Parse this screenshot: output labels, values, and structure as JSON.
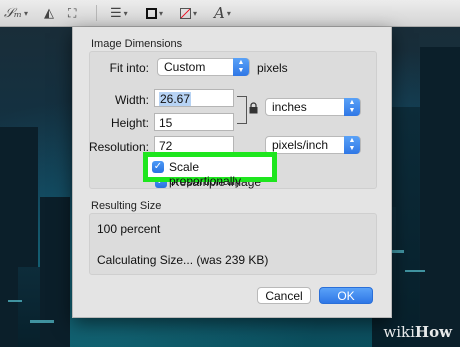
{
  "toolbar": {
    "tools": [
      {
        "name": "signature-icon"
      },
      {
        "name": "adjust-color-icon"
      },
      {
        "name": "adjust-size-icon"
      },
      {
        "name": "shape-style-icon"
      },
      {
        "name": "border-color-icon"
      },
      {
        "name": "fill-color-icon"
      },
      {
        "name": "text-style-icon"
      }
    ]
  },
  "dialog": {
    "image_dimensions_title": "Image Dimensions",
    "fit_into_label": "Fit into:",
    "fit_into_value": "Custom",
    "fit_into_unit": "pixels",
    "width_label": "Width:",
    "width_value": "26.67",
    "height_label": "Height:",
    "height_value": "15",
    "size_unit_value": "inches",
    "resolution_label": "Resolution:",
    "resolution_value": "72",
    "resolution_unit_value": "pixels/inch",
    "scale_proportionally_label": "Scale proportionally",
    "scale_proportionally_checked": true,
    "resample_label": "Resample image",
    "resample_checked": true,
    "resulting_size_title": "Resulting Size",
    "resulting_percent": "100 percent",
    "calculating_text": "Calculating Size... (was 239 KB)",
    "cancel_label": "Cancel",
    "ok_label": "OK"
  },
  "watermark": {
    "text_a": "wiki",
    "text_b": "How"
  },
  "colors": {
    "accent_blue": "#2f77e6",
    "highlight_green": "#1ee61e",
    "dialog_bg": "#e4e4e4"
  }
}
